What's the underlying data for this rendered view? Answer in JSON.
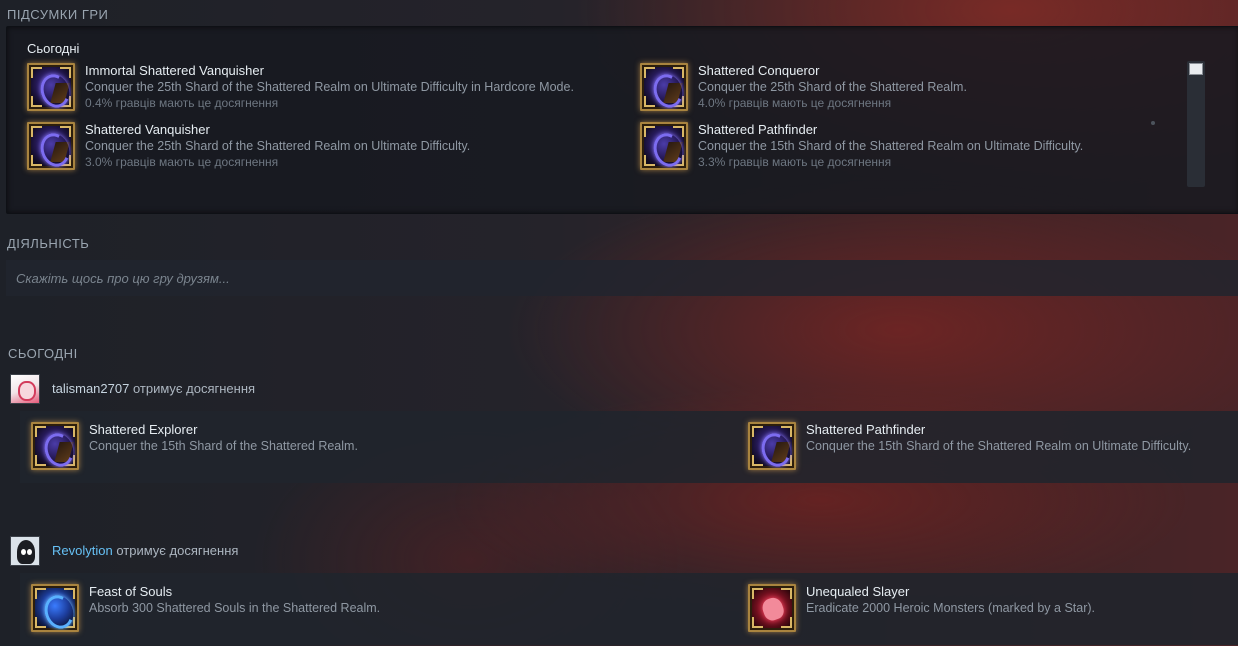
{
  "summary": {
    "title": "ПІДСУМКИ ГРИ",
    "today_label": "Сьогодні",
    "achievements": [
      {
        "name": "Immortal Shattered Vanquisher",
        "desc": "Conquer the 25th Shard of the Shattered Realm on Ultimate Difficulty in Hardcore Mode.",
        "pct": "0.4% гравців мають це досягнення",
        "icon": "shattered-realm-icon"
      },
      {
        "name": "Shattered Vanquisher",
        "desc": "Conquer the 25th Shard of the Shattered Realm on Ultimate Difficulty.",
        "pct": "3.0% гравців мають це досягнення",
        "icon": "shattered-realm-icon"
      },
      {
        "name": "Shattered Conqueror",
        "desc": "Conquer the 25th Shard of the Shattered Realm.",
        "pct": "4.0% гравців мають це досягнення",
        "icon": "shattered-realm-icon"
      },
      {
        "name": "Shattered Pathfinder",
        "desc": "Conquer the 15th Shard of the Shattered Realm on Ultimate Difficulty.",
        "pct": "3.3% гравців мають це досягнення",
        "icon": "shattered-realm-icon"
      }
    ]
  },
  "activity": {
    "title": "ДІЯЛЬНІСТЬ",
    "input_placeholder": "Скажіть щось про цю гру друзям..."
  },
  "feed": {
    "title": "СЬОГОДНІ",
    "entries": [
      {
        "user": "talisman2707",
        "action": " отримує досягнення",
        "achievements": [
          {
            "name": "Shattered Explorer",
            "desc": "Conquer the 15th Shard of the Shattered Realm.",
            "icon": "shattered-realm-icon"
          },
          {
            "name": "Shattered Pathfinder",
            "desc": "Conquer the 15th Shard of the Shattered Realm on Ultimate Difficulty.",
            "icon": "shattered-realm-icon"
          }
        ]
      },
      {
        "user": "Revolytion",
        "action": " отримує досягнення",
        "achievements": [
          {
            "name": "Feast of Souls",
            "desc": "Absorb 300 Shattered Souls in the Shattered Realm.",
            "icon": "blue-soul-icon"
          },
          {
            "name": "Unequaled Slayer",
            "desc": "Eradicate 2000 Heroic Monsters (marked by a Star).",
            "icon": "red-skull-icon"
          }
        ]
      }
    ]
  },
  "colors": {
    "link": "#66c0f4",
    "accent_gold": "#a9843f"
  }
}
